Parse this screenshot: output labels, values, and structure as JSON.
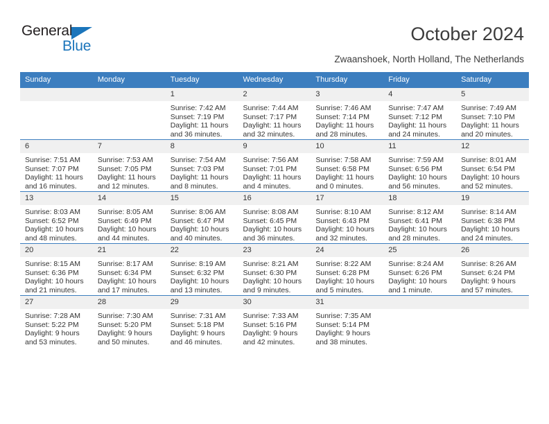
{
  "brand": {
    "name_dark": "General",
    "name_blue": "Blue",
    "accent_color": "#1b75bb",
    "header_color": "#3c7ebf"
  },
  "header": {
    "title": "October 2024",
    "subtitle": "Zwaanshoek, North Holland, The Netherlands"
  },
  "calendar": {
    "weekday_headers": [
      "Sunday",
      "Monday",
      "Tuesday",
      "Wednesday",
      "Thursday",
      "Friday",
      "Saturday"
    ],
    "labels": {
      "sunrise": "Sunrise:",
      "sunset": "Sunset:",
      "daylight": "Daylight:"
    },
    "weeks": [
      [
        {
          "day": "",
          "blank": true
        },
        {
          "day": "",
          "blank": true
        },
        {
          "day": "1",
          "sunrise": "Sunrise: 7:42 AM",
          "sunset": "Sunset: 7:19 PM",
          "daylight": "Daylight: 11 hours and 36 minutes."
        },
        {
          "day": "2",
          "sunrise": "Sunrise: 7:44 AM",
          "sunset": "Sunset: 7:17 PM",
          "daylight": "Daylight: 11 hours and 32 minutes."
        },
        {
          "day": "3",
          "sunrise": "Sunrise: 7:46 AM",
          "sunset": "Sunset: 7:14 PM",
          "daylight": "Daylight: 11 hours and 28 minutes."
        },
        {
          "day": "4",
          "sunrise": "Sunrise: 7:47 AM",
          "sunset": "Sunset: 7:12 PM",
          "daylight": "Daylight: 11 hours and 24 minutes."
        },
        {
          "day": "5",
          "sunrise": "Sunrise: 7:49 AM",
          "sunset": "Sunset: 7:10 PM",
          "daylight": "Daylight: 11 hours and 20 minutes."
        }
      ],
      [
        {
          "day": "6",
          "sunrise": "Sunrise: 7:51 AM",
          "sunset": "Sunset: 7:07 PM",
          "daylight": "Daylight: 11 hours and 16 minutes."
        },
        {
          "day": "7",
          "sunrise": "Sunrise: 7:53 AM",
          "sunset": "Sunset: 7:05 PM",
          "daylight": "Daylight: 11 hours and 12 minutes."
        },
        {
          "day": "8",
          "sunrise": "Sunrise: 7:54 AM",
          "sunset": "Sunset: 7:03 PM",
          "daylight": "Daylight: 11 hours and 8 minutes."
        },
        {
          "day": "9",
          "sunrise": "Sunrise: 7:56 AM",
          "sunset": "Sunset: 7:01 PM",
          "daylight": "Daylight: 11 hours and 4 minutes."
        },
        {
          "day": "10",
          "sunrise": "Sunrise: 7:58 AM",
          "sunset": "Sunset: 6:58 PM",
          "daylight": "Daylight: 11 hours and 0 minutes."
        },
        {
          "day": "11",
          "sunrise": "Sunrise: 7:59 AM",
          "sunset": "Sunset: 6:56 PM",
          "daylight": "Daylight: 10 hours and 56 minutes."
        },
        {
          "day": "12",
          "sunrise": "Sunrise: 8:01 AM",
          "sunset": "Sunset: 6:54 PM",
          "daylight": "Daylight: 10 hours and 52 minutes."
        }
      ],
      [
        {
          "day": "13",
          "sunrise": "Sunrise: 8:03 AM",
          "sunset": "Sunset: 6:52 PM",
          "daylight": "Daylight: 10 hours and 48 minutes."
        },
        {
          "day": "14",
          "sunrise": "Sunrise: 8:05 AM",
          "sunset": "Sunset: 6:49 PM",
          "daylight": "Daylight: 10 hours and 44 minutes."
        },
        {
          "day": "15",
          "sunrise": "Sunrise: 8:06 AM",
          "sunset": "Sunset: 6:47 PM",
          "daylight": "Daylight: 10 hours and 40 minutes."
        },
        {
          "day": "16",
          "sunrise": "Sunrise: 8:08 AM",
          "sunset": "Sunset: 6:45 PM",
          "daylight": "Daylight: 10 hours and 36 minutes."
        },
        {
          "day": "17",
          "sunrise": "Sunrise: 8:10 AM",
          "sunset": "Sunset: 6:43 PM",
          "daylight": "Daylight: 10 hours and 32 minutes."
        },
        {
          "day": "18",
          "sunrise": "Sunrise: 8:12 AM",
          "sunset": "Sunset: 6:41 PM",
          "daylight": "Daylight: 10 hours and 28 minutes."
        },
        {
          "day": "19",
          "sunrise": "Sunrise: 8:14 AM",
          "sunset": "Sunset: 6:38 PM",
          "daylight": "Daylight: 10 hours and 24 minutes."
        }
      ],
      [
        {
          "day": "20",
          "sunrise": "Sunrise: 8:15 AM",
          "sunset": "Sunset: 6:36 PM",
          "daylight": "Daylight: 10 hours and 21 minutes."
        },
        {
          "day": "21",
          "sunrise": "Sunrise: 8:17 AM",
          "sunset": "Sunset: 6:34 PM",
          "daylight": "Daylight: 10 hours and 17 minutes."
        },
        {
          "day": "22",
          "sunrise": "Sunrise: 8:19 AM",
          "sunset": "Sunset: 6:32 PM",
          "daylight": "Daylight: 10 hours and 13 minutes."
        },
        {
          "day": "23",
          "sunrise": "Sunrise: 8:21 AM",
          "sunset": "Sunset: 6:30 PM",
          "daylight": "Daylight: 10 hours and 9 minutes."
        },
        {
          "day": "24",
          "sunrise": "Sunrise: 8:22 AM",
          "sunset": "Sunset: 6:28 PM",
          "daylight": "Daylight: 10 hours and 5 minutes."
        },
        {
          "day": "25",
          "sunrise": "Sunrise: 8:24 AM",
          "sunset": "Sunset: 6:26 PM",
          "daylight": "Daylight: 10 hours and 1 minute."
        },
        {
          "day": "26",
          "sunrise": "Sunrise: 8:26 AM",
          "sunset": "Sunset: 6:24 PM",
          "daylight": "Daylight: 9 hours and 57 minutes."
        }
      ],
      [
        {
          "day": "27",
          "sunrise": "Sunrise: 7:28 AM",
          "sunset": "Sunset: 5:22 PM",
          "daylight": "Daylight: 9 hours and 53 minutes."
        },
        {
          "day": "28",
          "sunrise": "Sunrise: 7:30 AM",
          "sunset": "Sunset: 5:20 PM",
          "daylight": "Daylight: 9 hours and 50 minutes."
        },
        {
          "day": "29",
          "sunrise": "Sunrise: 7:31 AM",
          "sunset": "Sunset: 5:18 PM",
          "daylight": "Daylight: 9 hours and 46 minutes."
        },
        {
          "day": "30",
          "sunrise": "Sunrise: 7:33 AM",
          "sunset": "Sunset: 5:16 PM",
          "daylight": "Daylight: 9 hours and 42 minutes."
        },
        {
          "day": "31",
          "sunrise": "Sunrise: 7:35 AM",
          "sunset": "Sunset: 5:14 PM",
          "daylight": "Daylight: 9 hours and 38 minutes."
        },
        {
          "day": "",
          "blank": true
        },
        {
          "day": "",
          "blank": true
        }
      ]
    ]
  }
}
